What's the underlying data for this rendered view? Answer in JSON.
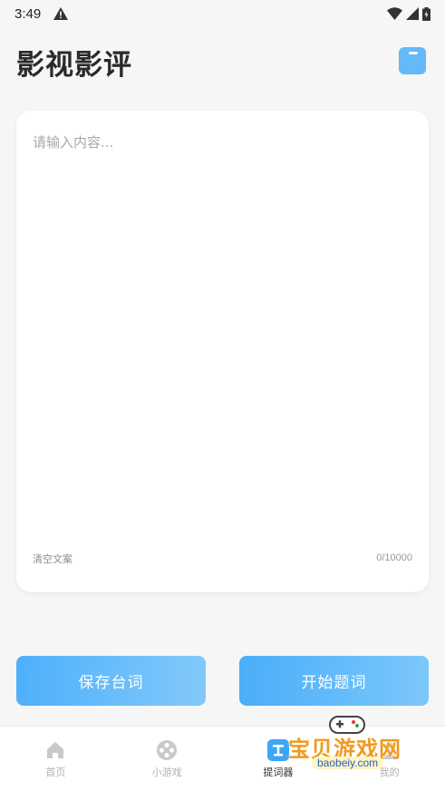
{
  "status_bar": {
    "time": "3:49",
    "icons": [
      "warning-icon",
      "wifi-icon",
      "signal-icon",
      "battery-icon"
    ]
  },
  "header": {
    "title": "影视影评",
    "action_icon": "save-document-icon"
  },
  "editor": {
    "placeholder": "请输入内容...",
    "value": "",
    "clear_label": "清空文案",
    "char_count": "0/10000"
  },
  "actions": {
    "save_label": "保存台词",
    "start_label": "开始题词"
  },
  "bottom_nav": {
    "items": [
      {
        "label": "首页",
        "icon": "home-icon",
        "active": false
      },
      {
        "label": "小游戏",
        "icon": "film-reel-icon",
        "active": false
      },
      {
        "label": "提词器",
        "icon": "teleprompter-icon",
        "active": true
      },
      {
        "label": "我的",
        "icon": "profile-icon",
        "active": false
      }
    ]
  },
  "watermark": {
    "text": "宝贝游戏网",
    "url": "baobeiy.com"
  },
  "colors": {
    "accent": "#5ab4f8",
    "background": "#f6f6f6",
    "card": "#ffffff",
    "watermark": "#f19a1e"
  }
}
